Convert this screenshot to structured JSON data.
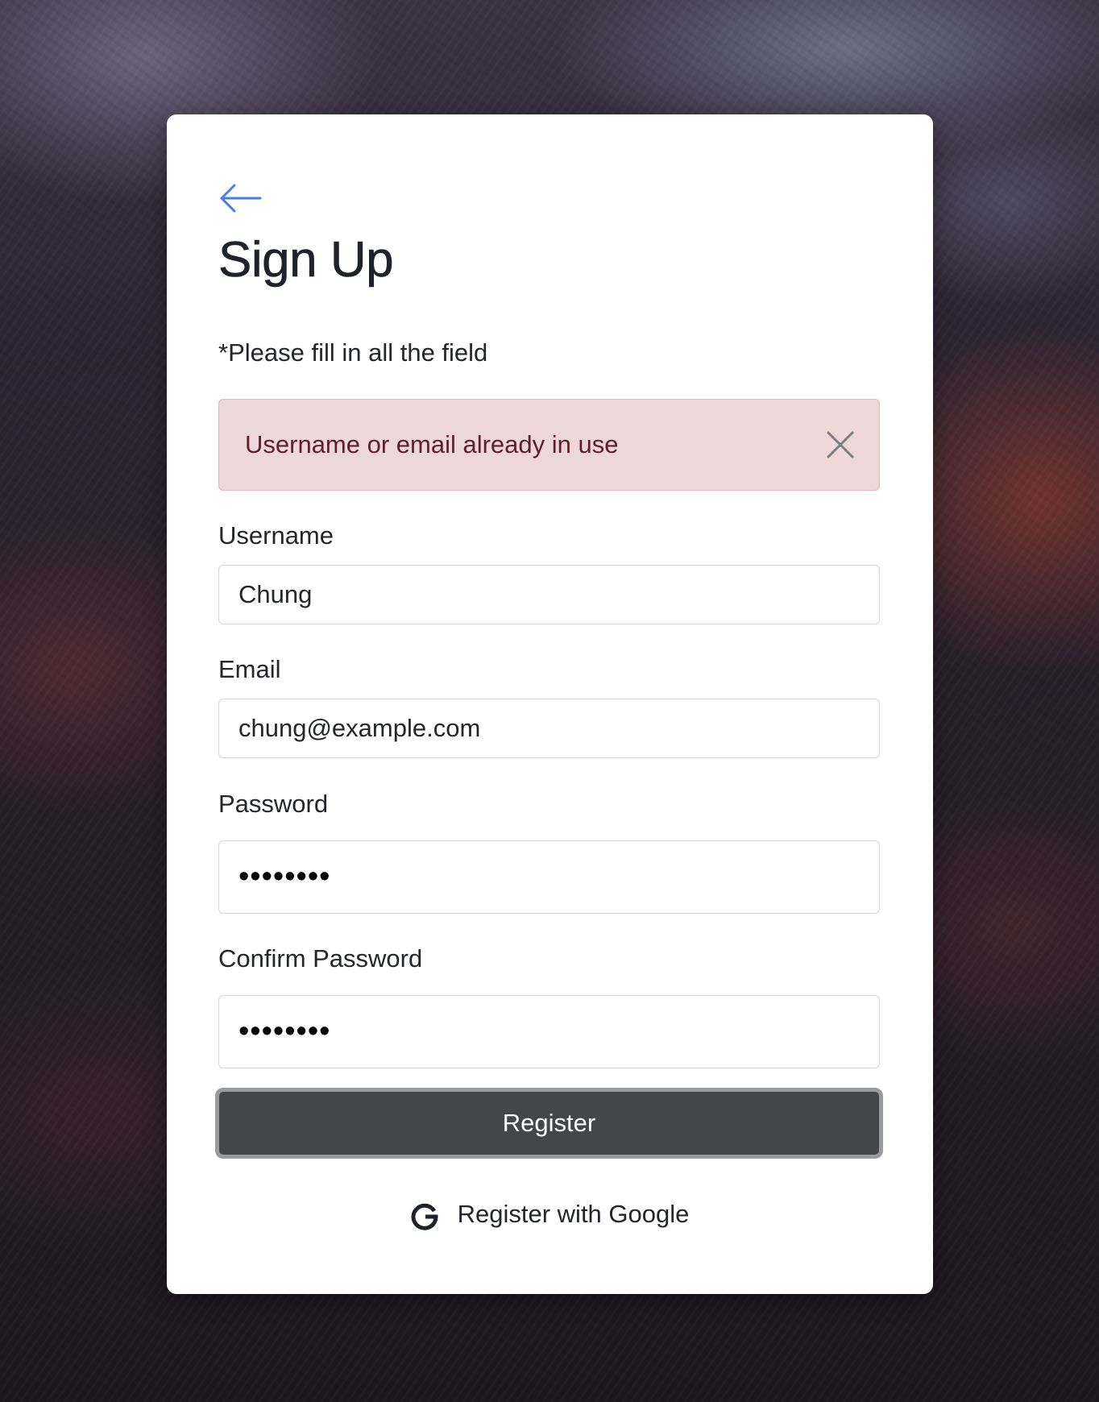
{
  "page": {
    "title": "Sign Up",
    "note": "*Please fill in all the field"
  },
  "alert": {
    "message": "Username or email already in use"
  },
  "form": {
    "username": {
      "label": "Username",
      "value": "Chung"
    },
    "email": {
      "label": "Email",
      "value": "chung@example.com"
    },
    "password": {
      "label": "Password",
      "value": "••••••••"
    },
    "confirm_password": {
      "label": "Confirm Password",
      "value": "••••••••"
    }
  },
  "actions": {
    "register_label": "Register",
    "google_label": "Register with Google"
  },
  "icons": {
    "back": "arrow-left-icon",
    "close": "close-icon",
    "google": "google-g-icon"
  },
  "colors": {
    "accent_link": "#4a7de3",
    "alert_bg": "#edd7d9",
    "alert_text": "#5f1f28",
    "primary_button": "#45464a"
  }
}
